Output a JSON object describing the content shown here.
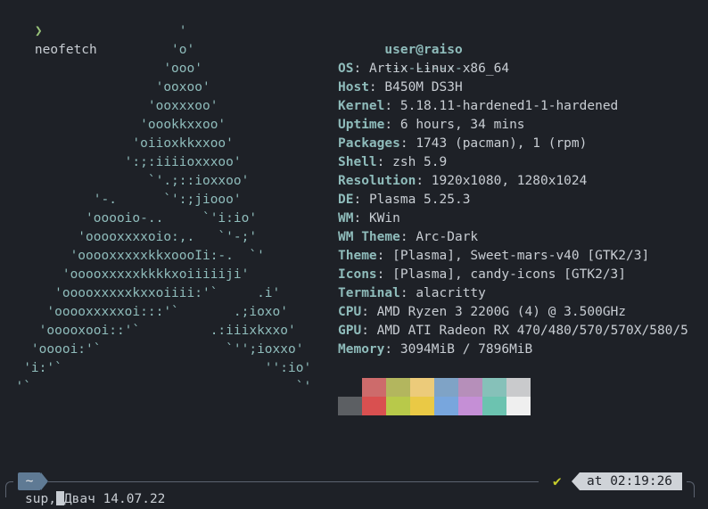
{
  "prompt": {
    "arrow": "❯",
    "command": "neofetch"
  },
  "ascii_art": [
    "                       '",
    "                      'o'",
    "                     'ooo'",
    "                    'ooxoo'",
    "                   'ooxxxoo'",
    "                  'oookkxxoo'",
    "                 'oiioxkkxxoo'",
    "                ':;:iiiioxxxoo'",
    "                   `'.;::ioxxoo'",
    "            '-.      `':;jiooo'",
    "           'ooooio-..     `'i:io'",
    "          'ooooxxxxoio:,.   `'-;'",
    "         'ooooxxxxxkkxoooIi:-.  `'",
    "        'ooooxxxxxkkkkxoiiiiiji'",
    "       'ooooxxxxxkxxoiiii:'`     .i'",
    "      'ooooxxxxxoi:::'`       .;ioxo'",
    "     'ooooxooi::'`         .:iiixkxxo'",
    "    'ooooi:'`                `'';ioxxo'",
    "   'i:'`                          '':io'",
    "  '`                                  `'"
  ],
  "info": {
    "title": "user@raiso",
    "separator": "----------",
    "fields": [
      {
        "key": "OS",
        "value": "Artix Linux x86_64"
      },
      {
        "key": "Host",
        "value": "B450M DS3H"
      },
      {
        "key": "Kernel",
        "value": "5.18.11-hardened1-1-hardened"
      },
      {
        "key": "Uptime",
        "value": "6 hours, 34 mins"
      },
      {
        "key": "Packages",
        "value": "1743 (pacman), 1 (rpm)"
      },
      {
        "key": "Shell",
        "value": "zsh 5.9"
      },
      {
        "key": "Resolution",
        "value": "1920x1080, 1280x1024"
      },
      {
        "key": "DE",
        "value": "Plasma 5.25.3"
      },
      {
        "key": "WM",
        "value": "KWin"
      },
      {
        "key": "WM Theme",
        "value": "Arc-Dark"
      },
      {
        "key": "Theme",
        "value": "[Plasma], Sweet-mars-v40 [GTK2/3]"
      },
      {
        "key": "Icons",
        "value": "[Plasma], candy-icons [GTK2/3]"
      },
      {
        "key": "Terminal",
        "value": "alacritty"
      },
      {
        "key": "CPU",
        "value": "AMD Ryzen 3 2200G (4) @ 3.500GHz"
      },
      {
        "key": "GPU",
        "value": "AMD ATI Radeon RX 470/480/570/570X/580/5"
      },
      {
        "key": "Memory",
        "value": "3094MiB / 7896MiB"
      }
    ]
  },
  "palette": {
    "row1": [
      "#1e2127",
      "#cd6b6b",
      "#b3b65e",
      "#eccb7a",
      "#7fa3c6",
      "#b68fba",
      "#86c1b9",
      "#c9cacc"
    ],
    "row2": [
      "#5c5f63",
      "#d95050",
      "#b8c94a",
      "#eac945",
      "#78a6dd",
      "#c58fd6",
      "#6cc3b0",
      "#efefef"
    ]
  },
  "status_bar": {
    "dir": "~",
    "check": "✔",
    "time_prefix": "at",
    "time": "02:19:26"
  },
  "input": {
    "text_before_cursor": "sup,",
    "text_after_cursor": "Двач 14.07.22"
  }
}
